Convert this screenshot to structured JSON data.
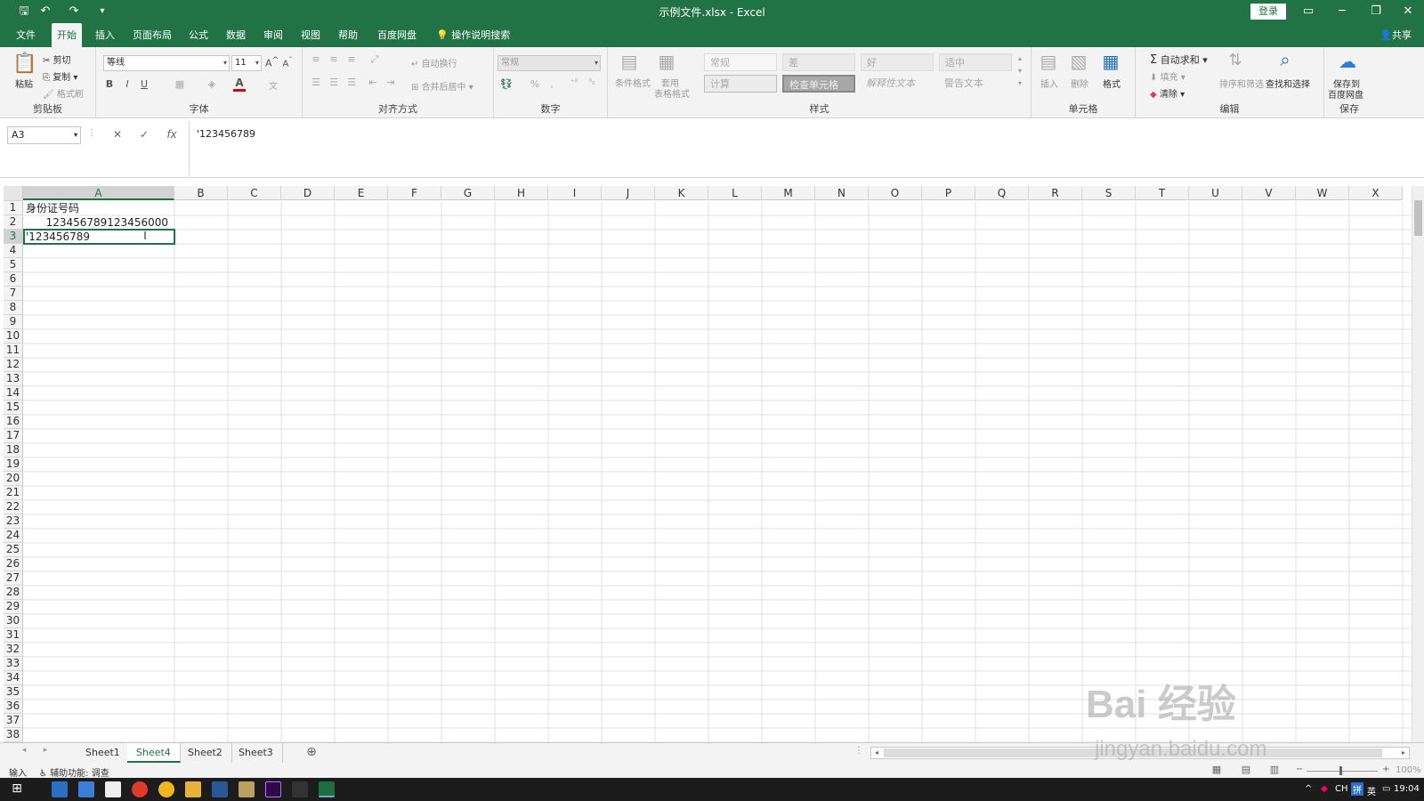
{
  "window": {
    "title": "示例文件.xlsx  -  Excel",
    "login_label": "登录",
    "accent": "#217346"
  },
  "tabs": [
    "文件",
    "开始",
    "插入",
    "页面布局",
    "公式",
    "数据",
    "审阅",
    "视图",
    "帮助",
    "百度网盘"
  ],
  "tell_me": "操作说明搜索",
  "share_label": "共享",
  "ribbon": {
    "clipboard": {
      "paste": "粘贴",
      "cut": "剪切",
      "copy": "复制",
      "format_painter": "格式刷",
      "label": "剪贴板"
    },
    "font": {
      "font_name": "等线",
      "font_size": "11",
      "bold": "B",
      "italic": "I",
      "underline": "U",
      "font_color": "A",
      "wen": "文",
      "label": "字体"
    },
    "alignment": {
      "wrap": "自动换行",
      "merge": "合并后居中",
      "label": "对齐方式"
    },
    "number": {
      "format": "常规",
      "percent": "%",
      "comma": ",",
      "label": "数字"
    },
    "styles": {
      "cond_format": "条件格式",
      "table_format_1": "套用",
      "table_format_2": "表格格式",
      "cells": [
        "常规",
        "差",
        "好",
        "适中",
        "计算",
        "检查单元格",
        "解释性文本",
        "警告文本"
      ],
      "label": "样式"
    },
    "cells": {
      "insert": "插入",
      "delete": "删除",
      "format": "格式",
      "label": "单元格"
    },
    "editing": {
      "autosum": "自动求和",
      "fill": "填充",
      "clear": "清除",
      "sort": "排序和筛选",
      "find": "查找和选择",
      "label": "编辑"
    },
    "save": {
      "save_1": "保存到",
      "save_2": "百度网盘",
      "label": "保存"
    }
  },
  "formula_bar": {
    "name_box": "A3",
    "cancel": "✕",
    "enter": "✓",
    "fx": "fx",
    "content": "'123456789"
  },
  "grid": {
    "columns": [
      "A",
      "B",
      "C",
      "D",
      "E",
      "F",
      "G",
      "H",
      "I",
      "J",
      "K",
      "L",
      "M",
      "N",
      "O",
      "P",
      "Q",
      "R",
      "S",
      "T",
      "U",
      "V",
      "W",
      "X"
    ],
    "rows": [
      "1",
      "2",
      "3",
      "4",
      "5",
      "6",
      "7",
      "8",
      "9",
      "10",
      "11",
      "12",
      "13",
      "14",
      "15",
      "16",
      "17",
      "18",
      "19",
      "20",
      "21",
      "22",
      "23",
      "24",
      "25",
      "26",
      "27",
      "28",
      "29",
      "30",
      "31",
      "32",
      "33",
      "34",
      "35",
      "36",
      "37",
      "38"
    ],
    "cells": {
      "a1": "身份证号码",
      "a2": "123456789123456000",
      "a3": "'123456789"
    },
    "selected": "A3"
  },
  "sheets": [
    "Sheet1",
    "Sheet4",
    "Sheet2",
    "Sheet3"
  ],
  "active_sheet": "Sheet4",
  "status": {
    "mode": "输入",
    "accessibility": "辅助功能: 调查",
    "zoom": "100%"
  },
  "taskbar": {
    "lang": "CH",
    "ime": "英",
    "time": "19:04"
  },
  "watermark": {
    "brand": "Bai 经验",
    "url": "jingyan.baidu.com"
  }
}
